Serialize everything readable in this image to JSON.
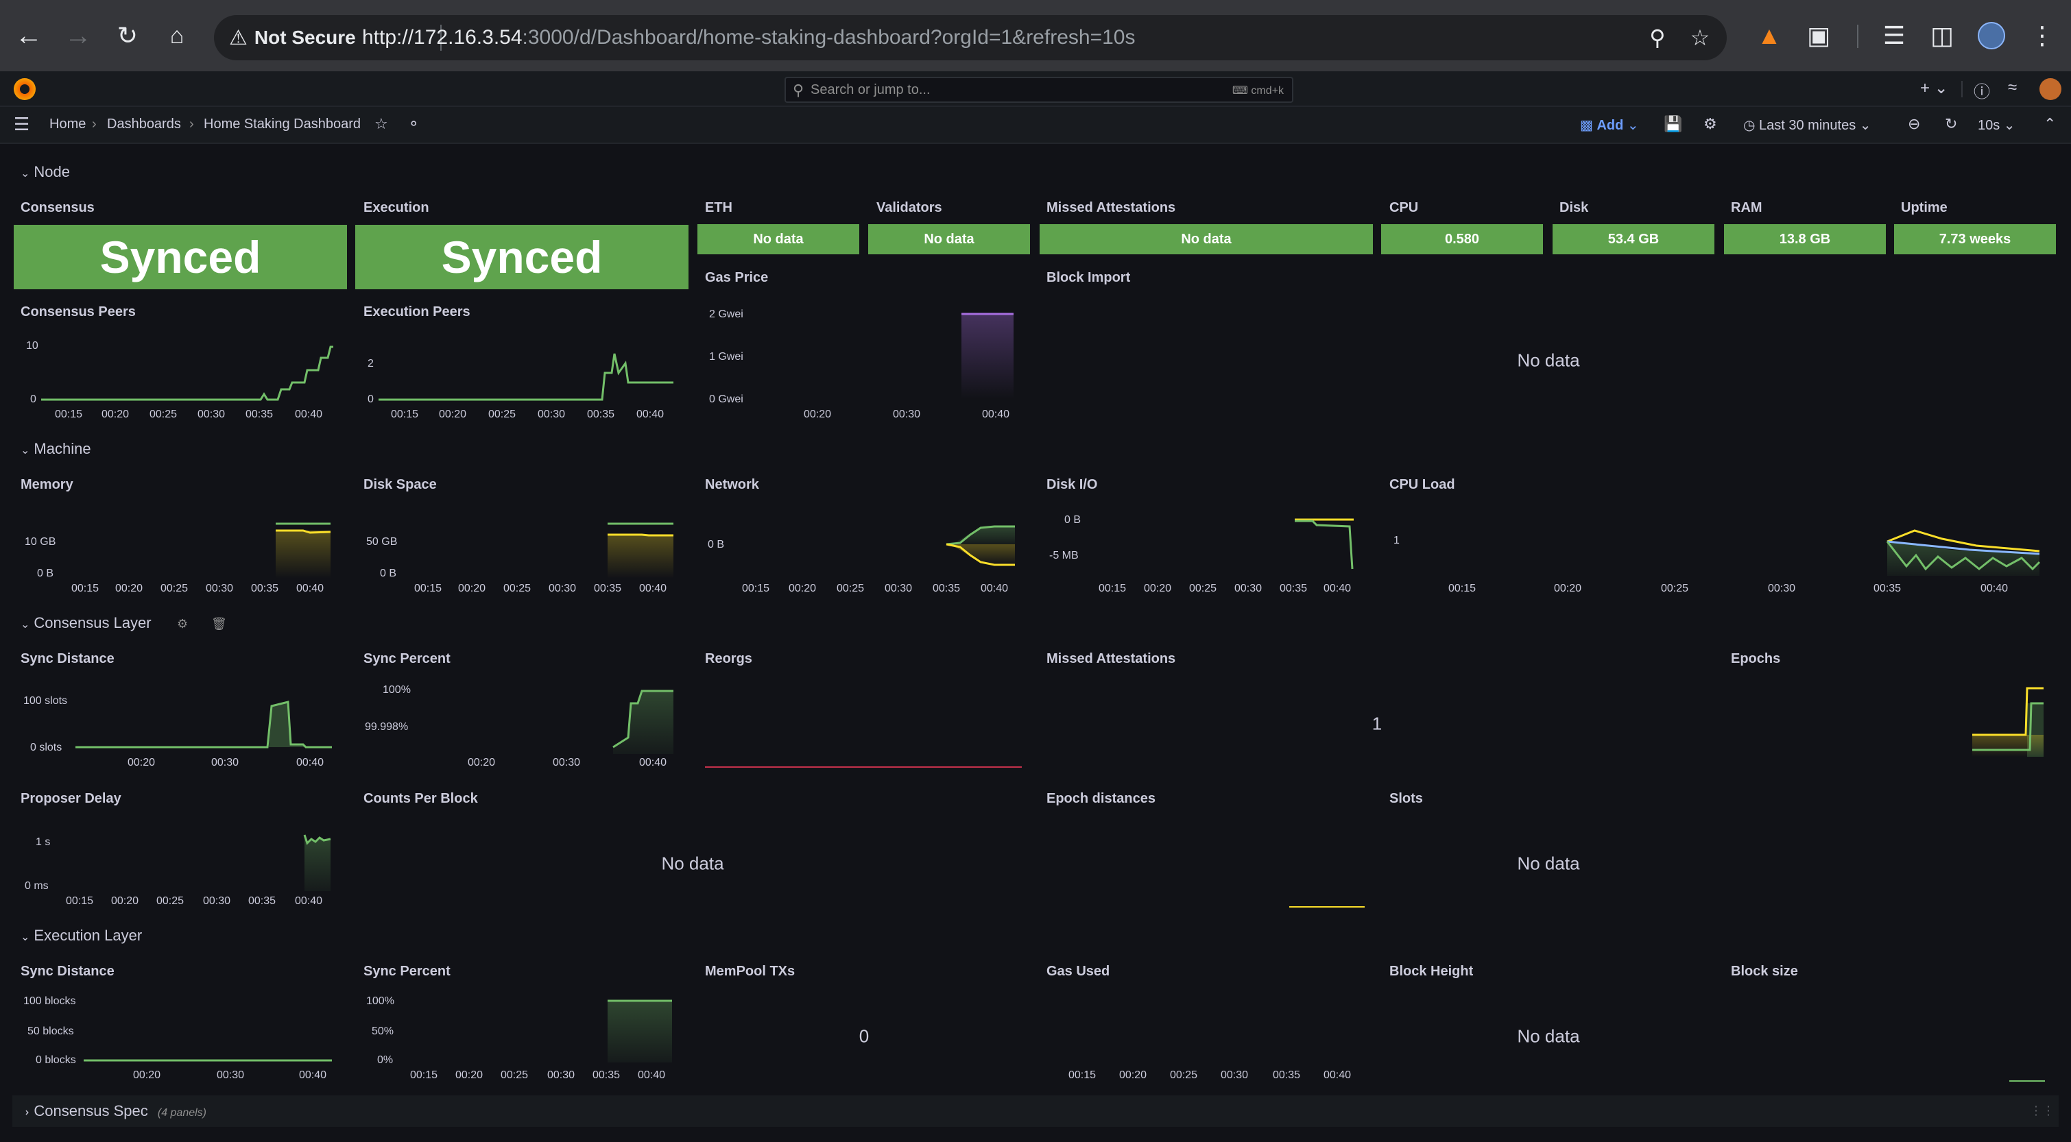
{
  "browser": {
    "security_label": "Not Secure",
    "url_host": "http://172.16.3.54",
    "url_rest": ":3000/d/Dashboard/home-staking-dashboard?orgId=1&refresh=10s"
  },
  "topbar": {
    "search_placeholder": "Search or jump to...",
    "search_shortcut": "cmd+k"
  },
  "breadcrumb": {
    "home": "Home",
    "dashboards": "Dashboards",
    "current": "Home Staking Dashboard"
  },
  "toolbar": {
    "add_label": "Add",
    "time_range": "Last 30 minutes",
    "refresh_interval": "10s"
  },
  "rows": {
    "node": "Node",
    "machine": "Machine",
    "consensus_layer": "Consensus Layer",
    "execution_layer": "Execution Layer",
    "consensus_spec": "Consensus Spec",
    "consensus_spec_count": "(4 panels)"
  },
  "node": {
    "consensus": {
      "title": "Consensus",
      "value": "Synced"
    },
    "execution": {
      "title": "Execution",
      "value": "Synced"
    },
    "eth": {
      "title": "ETH",
      "value": "No data"
    },
    "validators": {
      "title": "Validators",
      "value": "No data"
    },
    "missed_attestations": {
      "title": "Missed Attestations",
      "value": "No data"
    },
    "cpu": {
      "title": "CPU",
      "value": "0.580"
    },
    "disk": {
      "title": "Disk",
      "value": "53.4 GB"
    },
    "ram": {
      "title": "RAM",
      "value": "13.8 GB"
    },
    "uptime": {
      "title": "Uptime",
      "value": "7.73 weeks"
    },
    "gas_price": {
      "title": "Gas Price",
      "yticks": [
        "2 Gwei",
        "1 Gwei",
        "0 Gwei"
      ],
      "xticks": [
        "00:20",
        "00:30",
        "00:40"
      ]
    },
    "block_import": {
      "title": "Block Import",
      "value": "No data"
    },
    "consensus_peers": {
      "title": "Consensus Peers",
      "yticks": [
        "10",
        "0"
      ],
      "xticks": [
        "00:15",
        "00:20",
        "00:25",
        "00:30",
        "00:35",
        "00:40"
      ]
    },
    "execution_peers": {
      "title": "Execution Peers",
      "yticks": [
        "2",
        "0"
      ],
      "xticks": [
        "00:15",
        "00:20",
        "00:25",
        "00:30",
        "00:35",
        "00:40"
      ]
    }
  },
  "machine": {
    "memory": {
      "title": "Memory",
      "yticks": [
        "10 GB",
        "0 B"
      ],
      "xticks": [
        "00:15",
        "00:20",
        "00:25",
        "00:30",
        "00:35",
        "00:40"
      ]
    },
    "disk_space": {
      "title": "Disk Space",
      "yticks": [
        "50 GB",
        "0 B"
      ],
      "xticks": [
        "00:15",
        "00:20",
        "00:25",
        "00:30",
        "00:35",
        "00:40"
      ]
    },
    "network": {
      "title": "Network",
      "yticks": [
        "0 B"
      ],
      "xticks": [
        "00:15",
        "00:20",
        "00:25",
        "00:30",
        "00:35",
        "00:40"
      ]
    },
    "disk_io": {
      "title": "Disk I/O",
      "yticks": [
        "0 B",
        "-5 MB"
      ],
      "xticks": [
        "00:15",
        "00:20",
        "00:25",
        "00:30",
        "00:35",
        "00:40"
      ]
    },
    "cpu_load": {
      "title": "CPU Load",
      "yticks": [
        "1"
      ],
      "xticks": [
        "00:15",
        "00:20",
        "00:25",
        "00:30",
        "00:35",
        "00:40"
      ]
    }
  },
  "consensus_layer": {
    "sync_distance": {
      "title": "Sync Distance",
      "yticks": [
        "100 slots",
        "0 slots"
      ],
      "xticks": [
        "00:20",
        "00:30",
        "00:40"
      ]
    },
    "sync_percent": {
      "title": "Sync Percent",
      "yticks": [
        "100%",
        "99.998%"
      ],
      "xticks": [
        "00:20",
        "00:30",
        "00:40"
      ]
    },
    "reorgs": {
      "title": "Reorgs"
    },
    "missed_attestations": {
      "title": "Missed Attestations",
      "value": "1"
    },
    "epochs": {
      "title": "Epochs"
    },
    "proposer_delay": {
      "title": "Proposer Delay",
      "yticks": [
        "1 s",
        "0 ms"
      ],
      "xticks": [
        "00:15",
        "00:20",
        "00:25",
        "00:30",
        "00:35",
        "00:40"
      ]
    },
    "counts_per_block": {
      "title": "Counts Per Block",
      "value": "No data"
    },
    "epoch_distances": {
      "title": "Epoch distances"
    },
    "slots": {
      "title": "Slots",
      "value": "No data"
    }
  },
  "execution_layer": {
    "sync_distance": {
      "title": "Sync Distance",
      "yticks": [
        "100 blocks",
        "50 blocks",
        "0 blocks"
      ],
      "xticks": [
        "00:20",
        "00:30",
        "00:40"
      ]
    },
    "sync_percent": {
      "title": "Sync Percent",
      "yticks": [
        "100%",
        "50%",
        "0%"
      ],
      "xticks": [
        "00:15",
        "00:20",
        "00:25",
        "00:30",
        "00:35",
        "00:40"
      ]
    },
    "mempool_txs": {
      "title": "MemPool TXs",
      "value": "0"
    },
    "gas_used": {
      "title": "Gas Used",
      "xticks": [
        "00:15",
        "00:20",
        "00:25",
        "00:30",
        "00:35",
        "00:40"
      ]
    },
    "block_height": {
      "title": "Block Height",
      "value": "No data"
    },
    "block_size": {
      "title": "Block size"
    }
  },
  "colors": {
    "background": "#111217",
    "panel": "#181b1f",
    "stat_green": "#5fa34d",
    "series_green": "#73bf69",
    "series_yellow": "#fade2a",
    "series_purple": "#a76ee0",
    "series_blue": "#8ab8ff",
    "series_red": "#c4314b"
  }
}
